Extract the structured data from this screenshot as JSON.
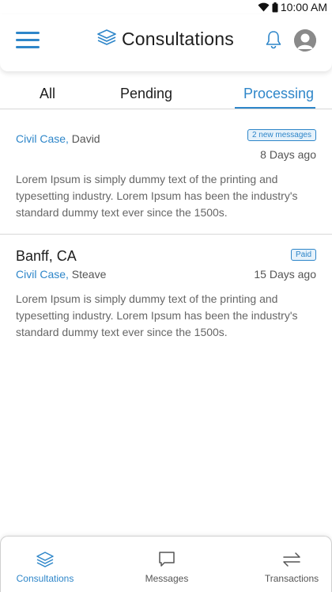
{
  "status_bar": {
    "time": "10:00 AM"
  },
  "header": {
    "title": "Consultations"
  },
  "tabs": [
    {
      "label": "All",
      "active": false
    },
    {
      "label": "Pending",
      "active": false
    },
    {
      "label": "Processing",
      "active": true
    }
  ],
  "consultations": [
    {
      "case_type": "Civil Case,",
      "client": "David",
      "badge": "2 new messages",
      "days_ago": "8 Days ago",
      "description": "Lorem Ipsum is simply dummy text of the printing and typesetting industry. Lorem Ipsum has been the industry's standard dummy text ever since the 1500s."
    },
    {
      "location": "Banff, CA",
      "case_type": "Civil Case,",
      "client": "Steave",
      "badge": "Paid",
      "days_ago": "15 Days ago",
      "description": "Lorem Ipsum is simply dummy text of the printing and typesetting industry. Lorem Ipsum has been the industry's standard dummy text ever since the 1500s."
    }
  ],
  "bottom_nav": [
    {
      "label": "Consultations",
      "icon": "layers-icon",
      "active": true
    },
    {
      "label": "Messages",
      "icon": "message-icon",
      "active": false
    },
    {
      "label": "Transactions",
      "icon": "transfer-icon",
      "active": false
    }
  ],
  "colors": {
    "accent": "#2e86c9",
    "text": "#1d1d1d",
    "muted": "#555555",
    "divider": "#d8d8d8"
  }
}
